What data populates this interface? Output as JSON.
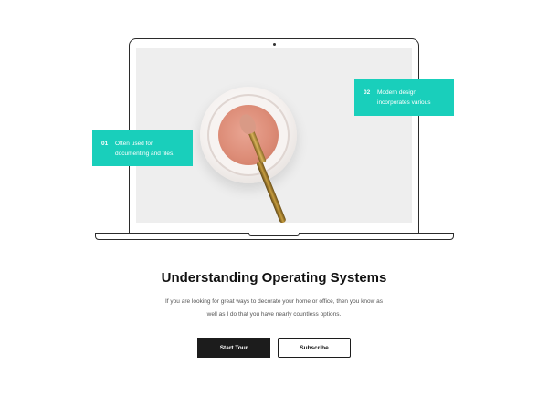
{
  "callouts": [
    {
      "number": "01",
      "text": "Often used for documenting and files."
    },
    {
      "number": "02",
      "text": "Modern design incorporates various"
    }
  ],
  "heading": "Understanding Operating Systems",
  "description": "If you are looking for great ways to decorate your home or office, then you know as well as I do that you have nearly countless options.",
  "buttons": {
    "primary_label": "Start Tour",
    "secondary_label": "Subscribe"
  },
  "colors": {
    "accent": "#19cfbb",
    "primary_button": "#1c1c1c",
    "text": "#111111"
  },
  "icons": [
    "laptop-illustration",
    "makeup-jar-image",
    "makeup-brush-image"
  ]
}
